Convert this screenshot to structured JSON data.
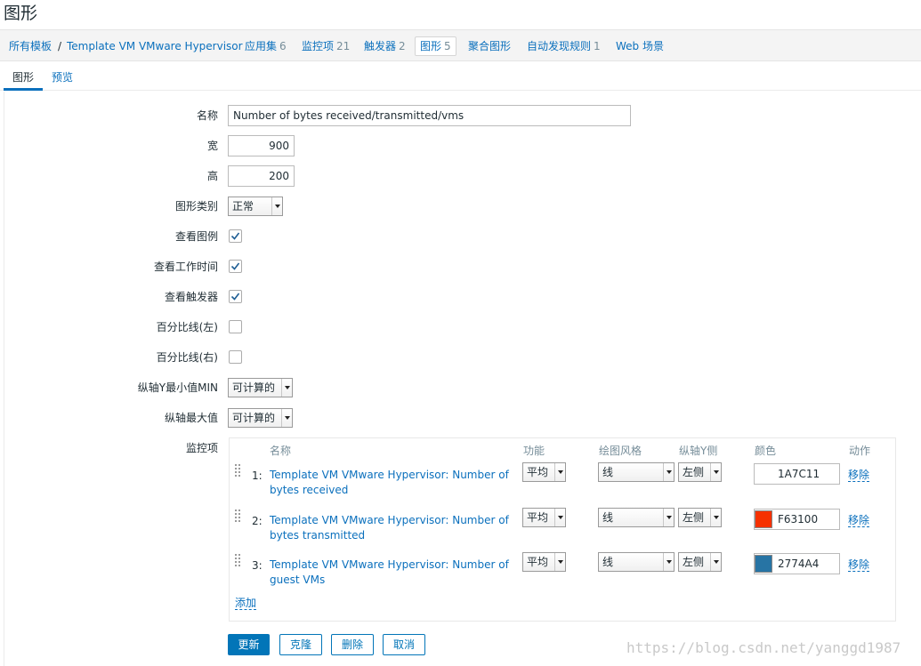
{
  "page": {
    "title": "图形"
  },
  "breadcrumb": {
    "all_templates": "所有模板",
    "separator": "/",
    "template": "Template VM VMware Hypervisor",
    "applications": {
      "label": "应用集",
      "count": "6"
    },
    "items": {
      "label": "监控项",
      "count": "21"
    },
    "triggers": {
      "label": "触发器",
      "count": "2"
    },
    "graphs": {
      "label": "图形",
      "count": "5"
    },
    "screens": {
      "label": "聚合图形"
    },
    "discovery": {
      "label": "自动发现规则",
      "count": "1"
    },
    "web": {
      "label": "Web 场景"
    }
  },
  "tabs": {
    "graph": "图形",
    "preview": "预览"
  },
  "form": {
    "name_label": "名称",
    "name_value": "Number of bytes received/transmitted/vms",
    "width_label": "宽",
    "width_value": "900",
    "height_label": "高",
    "height_value": "200",
    "type_label": "图形类别",
    "type_value": "正常",
    "show_legend_label": "查看图例",
    "show_legend": true,
    "show_worktime_label": "查看工作时间",
    "show_worktime": true,
    "show_triggers_label": "查看触发器",
    "show_triggers": true,
    "percentile_left_label": "百分比线(左)",
    "percentile_left": false,
    "percentile_right_label": "百分比线(右)",
    "percentile_right": false,
    "ymin_label": "纵轴Y最小值MIN",
    "ymin_value": "可计算的",
    "ymax_label": "纵轴最大值",
    "ymax_value": "可计算的",
    "items_label": "监控项"
  },
  "items_table": {
    "headers": {
      "name": "名称",
      "function": "功能",
      "draw_style": "绘图风格",
      "y_axis_side": "纵轴Y侧",
      "color": "颜色",
      "action": "动作"
    },
    "rows": [
      {
        "num": "1:",
        "name": "Template VM VMware Hypervisor: Number of bytes received",
        "function": "平均",
        "draw_style": "线",
        "y_axis_side": "左侧",
        "color": "1A7C11",
        "color_hex": "#1A7C11",
        "action": "移除"
      },
      {
        "num": "2:",
        "name": "Template VM VMware Hypervisor: Number of bytes transmitted",
        "function": "平均",
        "draw_style": "线",
        "y_axis_side": "左侧",
        "color": "F63100",
        "color_hex": "#F63100",
        "action": "移除"
      },
      {
        "num": "3:",
        "name": "Template VM VMware Hypervisor: Number of guest VMs",
        "function": "平均",
        "draw_style": "线",
        "y_axis_side": "左侧",
        "color": "2774A4",
        "color_hex": "#2774A4",
        "action": "移除"
      }
    ],
    "add_label": "添加"
  },
  "buttons": {
    "update": "更新",
    "clone": "克隆",
    "delete": "删除",
    "cancel": "取消"
  },
  "watermark": "https://blog.csdn.net/yanggd1987",
  "colors": {
    "link": "#0b70bd",
    "primary": "#0275b8",
    "text": "#1f2c33",
    "muted": "#768d99"
  }
}
